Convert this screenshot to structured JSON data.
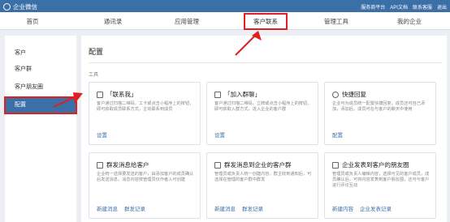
{
  "topbar": {
    "brand": "企业微信",
    "links": [
      "服务商平台",
      "API文档",
      "联系客服",
      "退出"
    ]
  },
  "nav": {
    "items": [
      "首页",
      "通讯录",
      "应用管理",
      "客户联系",
      "管理工具",
      "我的企业"
    ],
    "active_index": 3
  },
  "sidebar": {
    "items": [
      "客户",
      "客户群",
      "客户朋友圈",
      "配置"
    ],
    "active_index": 3
  },
  "main": {
    "title": "配置",
    "section_label": "工具",
    "cards": [
      {
        "title": "「联系我」",
        "desc": "客户通过扫描二维码、工卡或点击小程序上的按钮，即可获取成员联系方式，主动联系到成员",
        "actions": [
          "设置"
        ],
        "icon": "contact-me-icon"
      },
      {
        "title": "「加入群聊」",
        "desc": "客户通过扫描二维码、立牌或点击小程序上的按钮，即可获取入群方式，进入企业的客户群",
        "actions": [
          "设置"
        ],
        "icon": "qr-join-icon"
      },
      {
        "title": "快捷回复",
        "desc": "企业可为成员统一配置快捷回复，成员还可自己添加，添加后，成员可在与客户的聊天中使用",
        "actions": [
          "配置"
        ],
        "icon": "quick-reply-icon"
      },
      {
        "title": "群发消息给客户",
        "desc": "企业统一选择要发送的客户，由添加客户的成员确认后发送消息，消息内容按管理员仅作者人可创建",
        "actions": [
          "新建消息",
          "群发记录"
        ],
        "icon": "mass-message-icon"
      },
      {
        "title": "群发消息到企业的客户群",
        "desc": "管理员或负责人统一创建内容，群主收到通知后，可选择在管理的客户群中群发",
        "actions": [
          "新建消息",
          "群发记录"
        ],
        "icon": "group-broadcast-icon"
      },
      {
        "title": "企业发表到客户的朋友圈",
        "desc": "管理员或负责人编辑内容，选择可见的客户成员，成员确认后，可将内容发表到客户朋友圈，还可与客户进行评论互动",
        "actions": [
          "新建内容",
          "企业发表记录"
        ],
        "icon": "moments-icon"
      }
    ]
  },
  "colors": {
    "primary": "#3b6fa8",
    "highlight": "#e02020",
    "background": "#ebeef2"
  }
}
